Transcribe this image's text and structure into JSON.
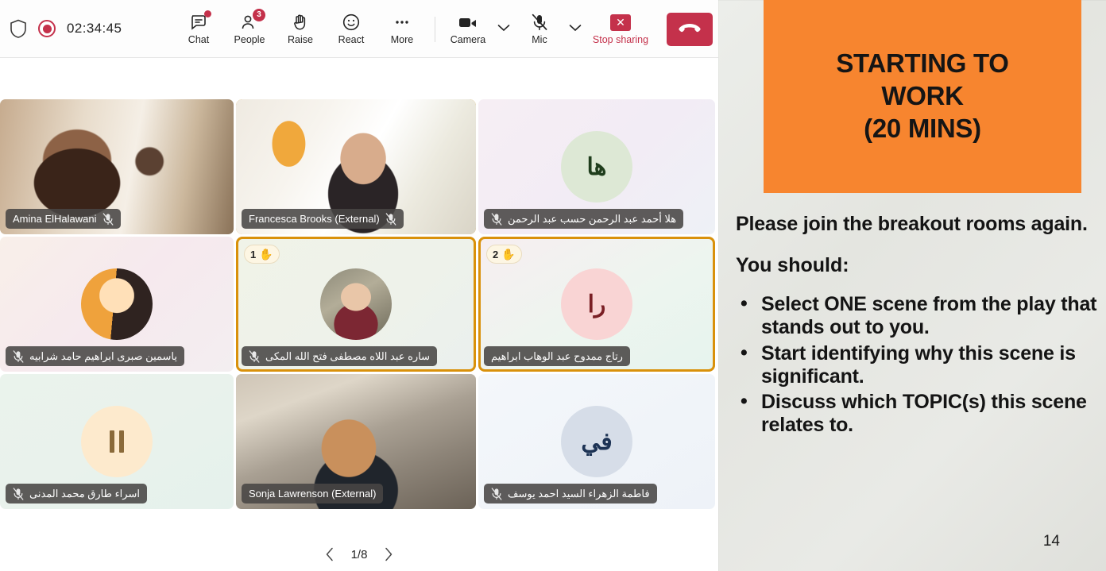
{
  "toolbar": {
    "timer": "02:34:45",
    "shield_icon": "shield-icon",
    "record_icon": "recording-indicator-icon",
    "buttons": [
      {
        "label": "Chat",
        "icon": "chat-icon",
        "badge": "",
        "badge_type": "dot"
      },
      {
        "label": "People",
        "icon": "people-icon",
        "badge": "3",
        "badge_type": "count"
      },
      {
        "label": "Raise",
        "icon": "raise-hand-icon",
        "badge": "",
        "badge_type": "none"
      },
      {
        "label": "React",
        "icon": "react-smiley-icon",
        "badge": "",
        "badge_type": "none"
      },
      {
        "label": "More",
        "icon": "more-ellipsis-icon",
        "badge": "",
        "badge_type": "none"
      }
    ],
    "camera_label": "Camera",
    "camera_icon": "camera-icon",
    "mic_label": "Mic",
    "mic_icon": "mic-muted-icon",
    "stop_sharing_label": "Stop sharing",
    "stop_sharing_icon": "stop-share-x-icon",
    "hangup_icon": "hangup-phone-icon",
    "chevron_icon": "chevron-down-icon",
    "accent_red": "#c4314b"
  },
  "grid": {
    "selected_border_color": "#d9910b",
    "tiles": [
      {
        "name": "Amina ElHalawani",
        "rtl": false,
        "kind": "video",
        "muted": true,
        "selected": false,
        "hand": "",
        "avatar_text": "",
        "avatar_bg": "",
        "avatar_fg": "",
        "tile_bg": "#c9a98a"
      },
      {
        "name": "Francesca Brooks (External)",
        "rtl": false,
        "kind": "video",
        "muted": true,
        "selected": true,
        "hand": "",
        "avatar_text": "",
        "avatar_bg": "",
        "avatar_fg": "",
        "tile_bg": "#e9e2d6"
      },
      {
        "name": "هلا أحمد عبد الرحمن حسب عبد الرحمن",
        "rtl": true,
        "kind": "avatar",
        "muted": true,
        "selected": false,
        "hand": "",
        "avatar_text": "ها",
        "avatar_bg": "#dde8d5",
        "avatar_fg": "#1f3d1c",
        "tile_bg": "#f3eaf2"
      },
      {
        "name": "ياسمين صبرى ابراهيم حامد شرابيه",
        "rtl": true,
        "kind": "avatar-photo",
        "muted": true,
        "selected": false,
        "hand": "",
        "avatar_text": "",
        "avatar_bg": "#f2d7a8",
        "avatar_fg": "#5a3b22",
        "tile_bg": "#f6ece9"
      },
      {
        "name": "ساره عبد اللاه مصطفى فتح الله المكى",
        "rtl": true,
        "kind": "avatar-photo",
        "muted": true,
        "selected": true,
        "hand": "1",
        "avatar_text": "",
        "avatar_bg": "#cfc3b4",
        "avatar_fg": "#333",
        "tile_bg": "#eef1e6"
      },
      {
        "name": "رتاج ممدوح عبد الوهاب ابراهيم",
        "rtl": true,
        "kind": "avatar",
        "muted": false,
        "selected": true,
        "hand": "2",
        "avatar_text": "را",
        "avatar_bg": "#f9d4d4",
        "avatar_fg": "#7a1f25",
        "tile_bg": "#e7f4ee"
      },
      {
        "name": "اسراء طارق محمد المدنى",
        "rtl": true,
        "kind": "pause",
        "muted": true,
        "selected": false,
        "hand": "",
        "avatar_text": "",
        "avatar_bg": "#fdeacd",
        "avatar_fg": "#8a6a3a",
        "tile_bg": "#e8f2ea"
      },
      {
        "name": "Sonja Lawrenson (External)",
        "rtl": false,
        "kind": "video",
        "muted": false,
        "selected": false,
        "hand": "",
        "avatar_text": "",
        "avatar_bg": "",
        "avatar_fg": "",
        "tile_bg": "#d6cec4"
      },
      {
        "name": "فاطمة الزهراء السيد احمد يوسف",
        "rtl": true,
        "kind": "avatar",
        "muted": true,
        "selected": false,
        "hand": "",
        "avatar_text": "في",
        "avatar_bg": "#d6dde8",
        "avatar_fg": "#1d3355",
        "tile_bg": "#f0f3f7"
      }
    ]
  },
  "pagination": {
    "prev_icon": "chevron-left-icon",
    "next_icon": "chevron-right-icon",
    "indicator": "1/8"
  },
  "slide": {
    "banner_color": "#f7852f",
    "banner_lines": [
      "STARTING TO",
      "WORK",
      "(20 MINS)"
    ],
    "heading": "Please join the breakout rooms again.",
    "subheading": "You should:",
    "bullets": [
      "Select ONE scene from the play that stands out to you.",
      "Start identifying why this scene is significant.",
      "Discuss which TOPIC(s) this scene relates to."
    ],
    "page_number": "14"
  }
}
